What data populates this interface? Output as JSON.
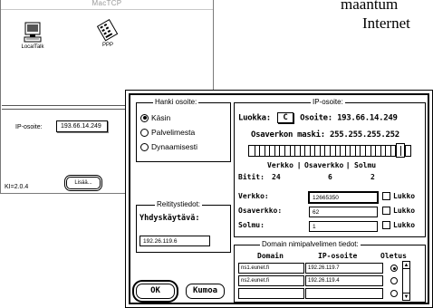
{
  "background_document": {
    "line1": "maantum",
    "line2": "Internet"
  },
  "mactcp": {
    "title": "MacTCP",
    "networks": [
      {
        "label": "LocalTalk",
        "icon": "computer-icon"
      },
      {
        "label": "PPP",
        "icon": "modem-phone-icon"
      }
    ],
    "ip_label": "IP-osoite:",
    "ip_value": "193.66.14.249",
    "version": "KI=2.0.4",
    "more_button": "Lisää..."
  },
  "dialog": {
    "obtain": {
      "legend": "Hanki osoite:",
      "options": [
        "Käsin",
        "Palvelimesta",
        "Dynaamisesti"
      ],
      "selected_index": 0
    },
    "ip": {
      "legend": "IP-osoite:",
      "class_label": "Luokka:",
      "class_value": "C",
      "address_label": "Osoite:",
      "address_value": "193.66.14.249",
      "mask_label": "Osaverkon maski:",
      "mask_value": "255.255.255.252",
      "slider_fraction": 0.94,
      "net_label": "Verkko",
      "subnet_label": "Osaverkko",
      "node_label": "Solmu",
      "bits_label": "Bitit:",
      "bits_net": "24",
      "bits_subnet": "6",
      "bits_node": "2",
      "network_label": "Verkko:",
      "network_value": "12665350",
      "subnet_field_label": "Osaverkko:",
      "subnet_value": "62",
      "node_field_label": "Solmu:",
      "node_value": "1",
      "lock_label": "Lukko"
    },
    "gateway": {
      "legend": "Reititystiedot:",
      "label": "Yhdyskäytävä:",
      "value": "192.26.119.6"
    },
    "dns": {
      "legend": "Domain nimipalvelimen tiedot:",
      "col_domain": "Domain",
      "col_ip": "IP-osoite",
      "col_default": "Oletus",
      "rows": [
        {
          "domain": "ns1.eunet.fi",
          "ip": "192.26.119.7",
          "default": true
        },
        {
          "domain": "ns2.eunet.fi",
          "ip": "192.26.119.4",
          "default": false
        },
        {
          "domain": "",
          "ip": "",
          "default": false
        }
      ]
    },
    "ok_label": "OK",
    "cancel_label": "Kumoa"
  }
}
